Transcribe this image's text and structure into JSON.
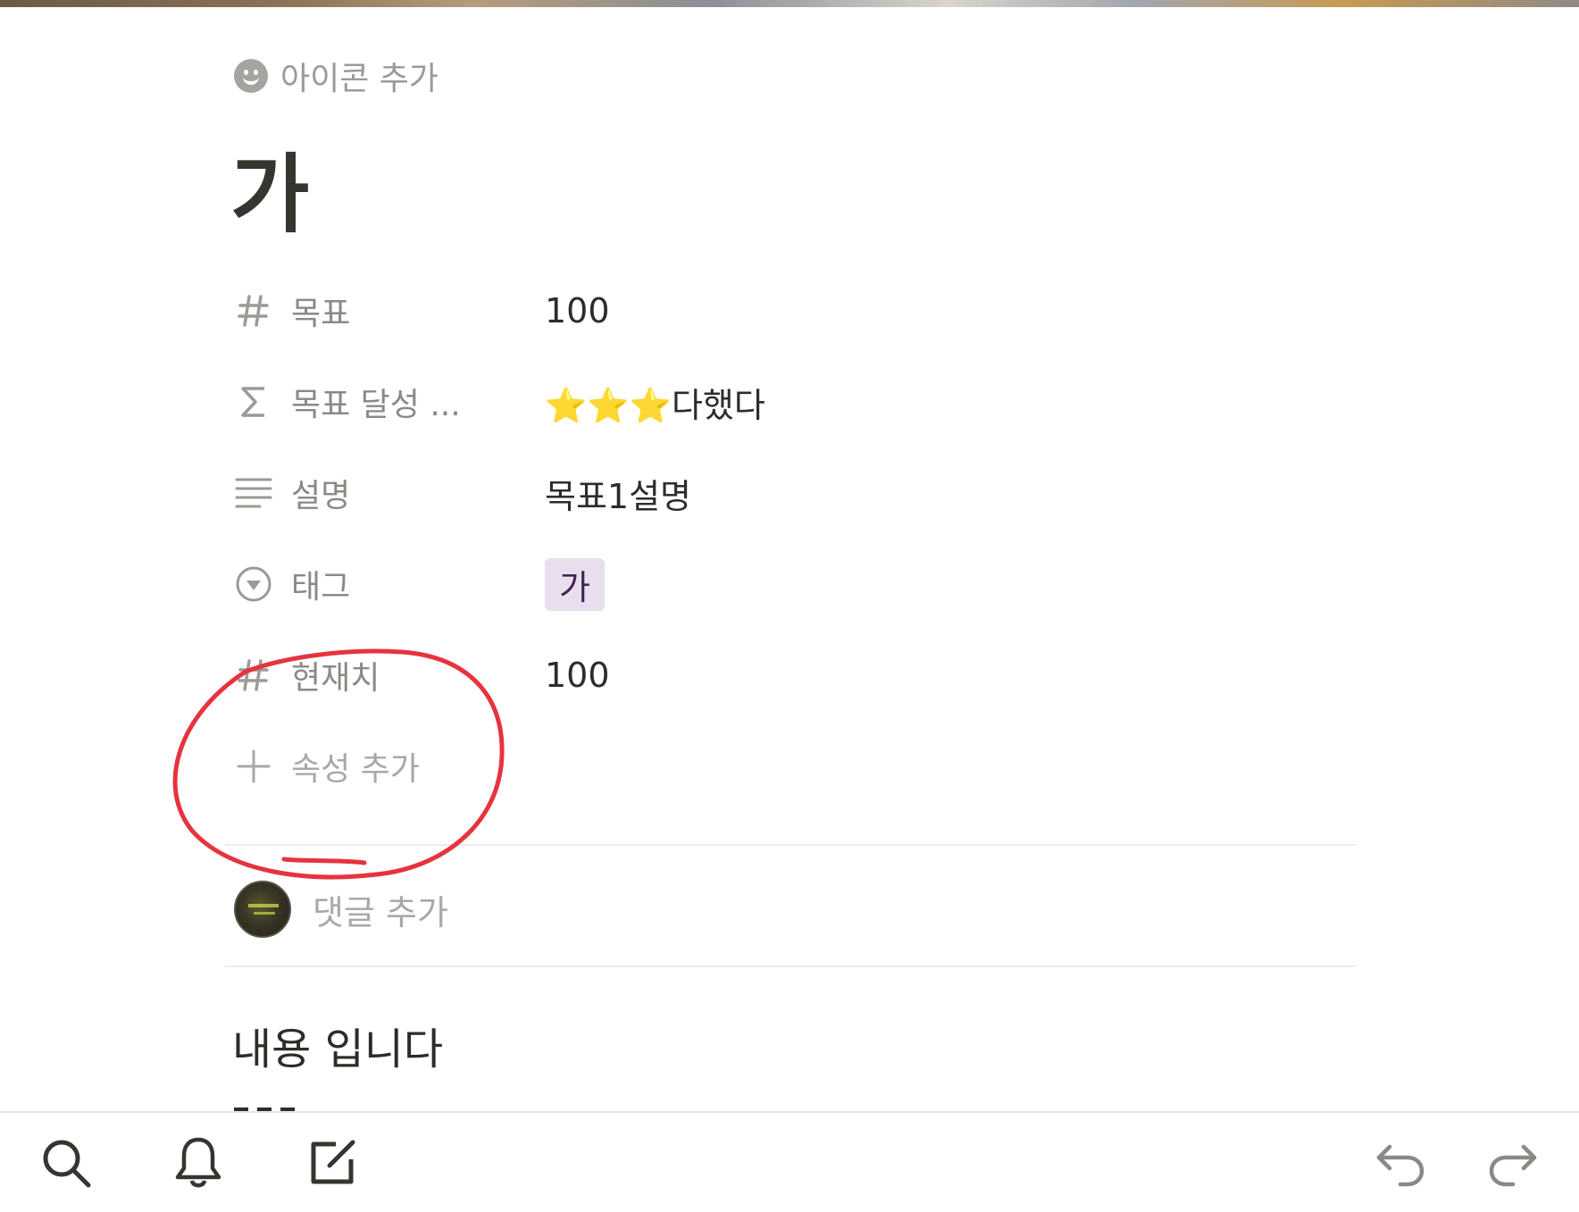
{
  "header": {
    "add_icon_label": "아이콘 추가",
    "title": "가"
  },
  "properties": [
    {
      "icon": "hash-icon",
      "name": "목표",
      "value": "100"
    },
    {
      "icon": "sigma-icon",
      "name": "목표 달성 ...",
      "value": "⭐⭐⭐다했다"
    },
    {
      "icon": "text-lines-icon",
      "name": "설명",
      "value": "목표1설명"
    },
    {
      "icon": "select-circle-icon",
      "name": "태그",
      "value": "가"
    },
    {
      "icon": "hash-icon",
      "name": "현재치",
      "value": "100"
    }
  ],
  "add_property": {
    "icon": "plus-icon",
    "label": "속성 추가"
  },
  "comments": {
    "placeholder": "댓글 추가"
  },
  "content": {
    "text": "내용 입니다"
  },
  "toolbar": {
    "left": [
      "search-icon",
      "bell-icon",
      "compose-icon"
    ],
    "right": [
      "undo-icon",
      "redo-icon"
    ]
  },
  "colors": {
    "tag_background": "#e8deee",
    "tag_text": "#412454",
    "annotation_circle": "#e5343e"
  }
}
